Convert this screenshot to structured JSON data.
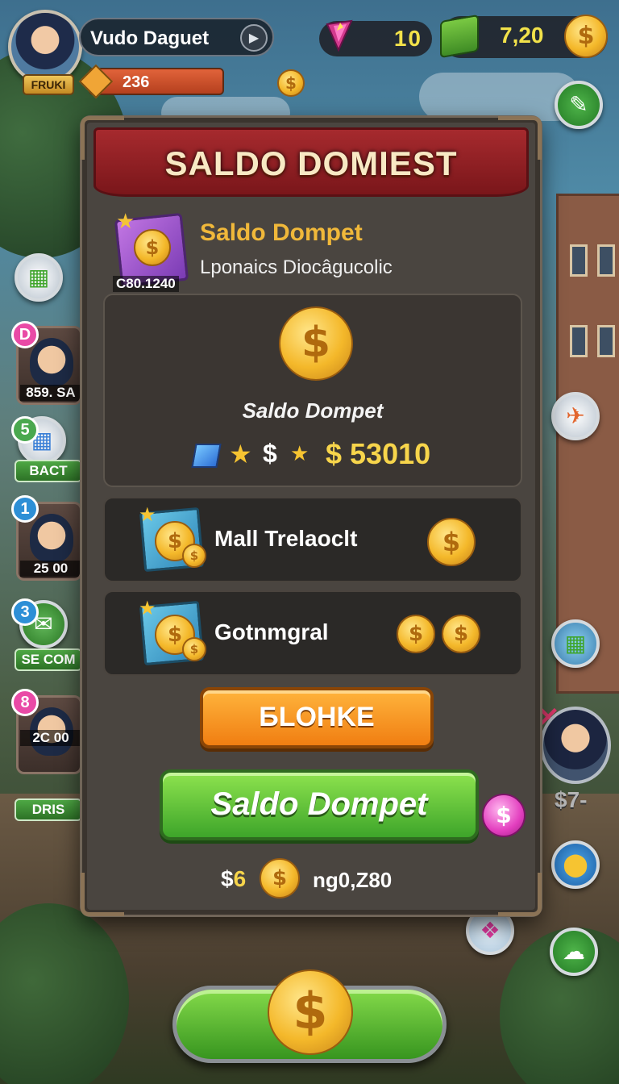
{
  "hud": {
    "player_name": "Vudo Daguet",
    "rank": "FRUKI",
    "level_value": "236",
    "gems": "10",
    "cash": "7,20"
  },
  "sidebar_left": [
    {
      "badge": "D",
      "badge_color": "#e94aa6",
      "value": "859. SA"
    },
    {
      "badge": "5",
      "badge_color": "#4aa84f",
      "label": "BACT"
    },
    {
      "badge": "1",
      "badge_color": "#2d8fd6",
      "value": "25 00"
    },
    {
      "badge": "3",
      "badge_color": "#2d8fd6",
      "label": "SE COM"
    },
    {
      "badge": "8",
      "badge_color": "#e94aa6",
      "value": "2C 00",
      "label": "DRIS"
    }
  ],
  "modal": {
    "title": "SALDO DOMIEST",
    "wallet_title": "Saldo Dompet",
    "wallet_subtitle": "Lponaics Diocâgucolic",
    "wallet_tag": "C80.1240",
    "balance_label": "Saldo Dompet",
    "balance_value": "$ 53010",
    "dollar_symbol": "$",
    "offers": [
      {
        "label": "Mall Trelaoclt"
      },
      {
        "label": "Gotnmgral"
      }
    ],
    "orange_button": "БLOHKE",
    "green_button": "Saldo Dompet",
    "footer_left_symbol": "$",
    "footer_left_value": "6",
    "footer_right": "ng0,Z80"
  },
  "right": {
    "tag": "$7-"
  },
  "colors": {
    "header_red": "#a62a2e",
    "gold": "#f4b82a",
    "green_button": "#3ea52a",
    "orange_button": "#f07e12"
  },
  "icons": [
    "gem-icon",
    "cash-stack-icon",
    "coin-icon",
    "wallet-icon",
    "gift-icon",
    "cloud-icon",
    "fan-icon"
  ]
}
